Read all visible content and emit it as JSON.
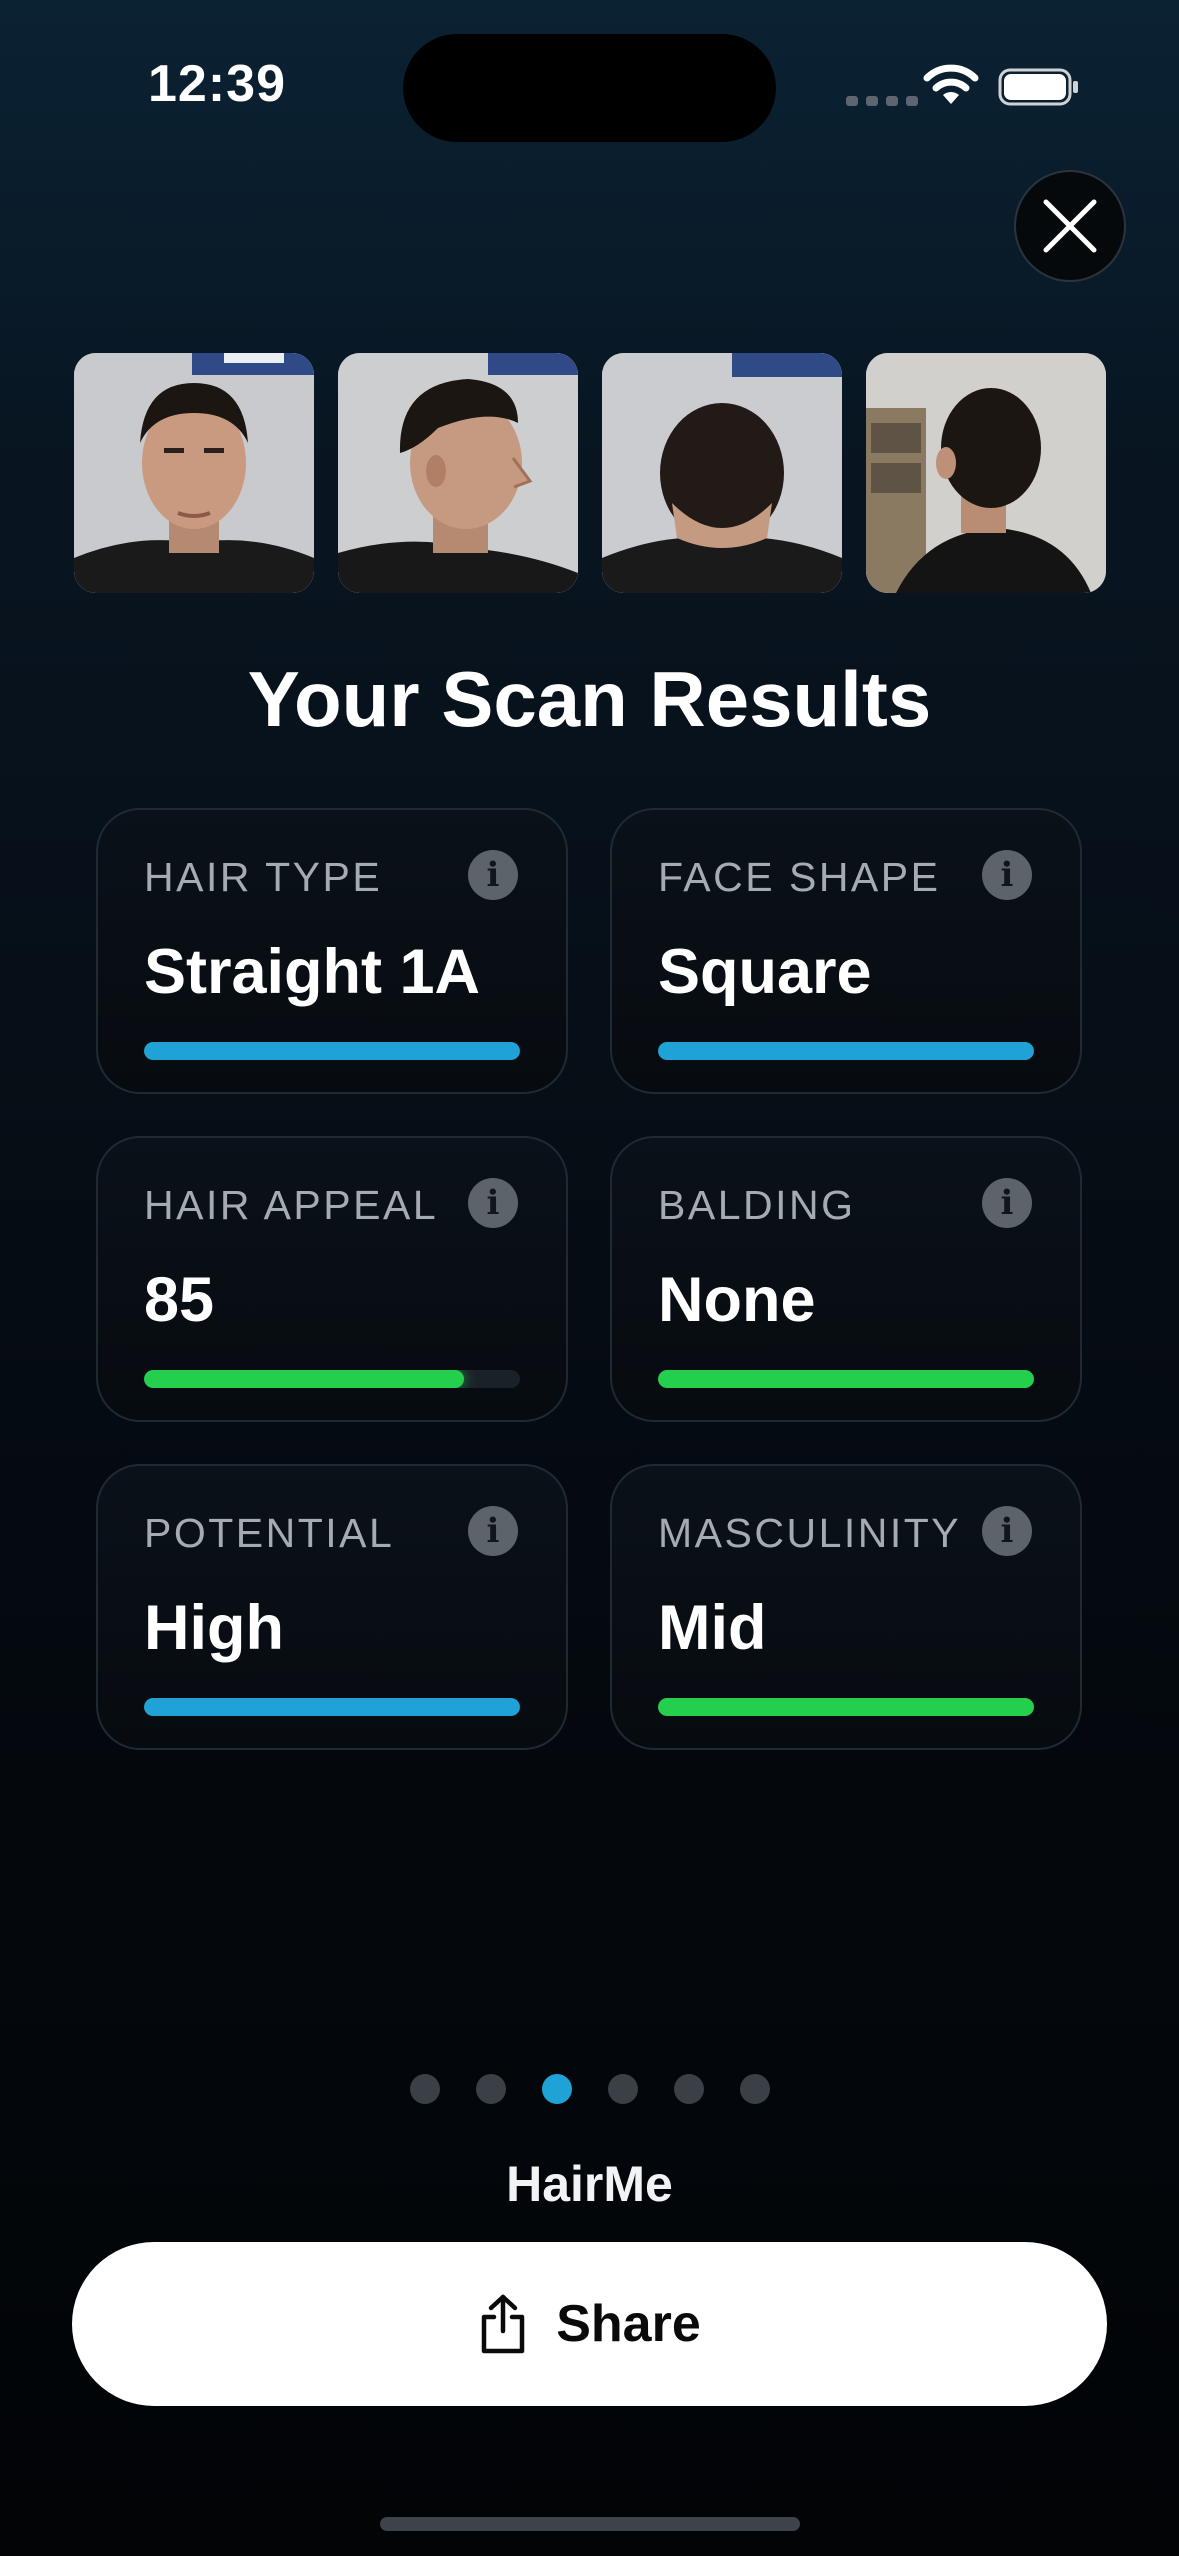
{
  "status_bar": {
    "time": "12:39"
  },
  "photos": [
    {
      "view": "front"
    },
    {
      "view": "side"
    },
    {
      "view": "top"
    },
    {
      "view": "back"
    }
  ],
  "title": "Your Scan Results",
  "cards": [
    {
      "label": "HAIR TYPE",
      "value": "Straight 1A",
      "bar_percent": 100,
      "bar_color": "#1fa3d6"
    },
    {
      "label": "FACE SHAPE",
      "value": "Square",
      "bar_percent": 100,
      "bar_color": "#1fa3d6"
    },
    {
      "label": "HAIR APPEAL",
      "value": "85",
      "bar_percent": 85,
      "bar_color": "#25cf4e"
    },
    {
      "label": "BALDING",
      "value": "None",
      "bar_percent": 100,
      "bar_color": "#25cf4e"
    },
    {
      "label": "POTENTIAL",
      "value": "High",
      "bar_percent": 100,
      "bar_color": "#1fa3d6"
    },
    {
      "label": "MASCULINITY",
      "value": "Mid",
      "bar_percent": 100,
      "bar_color": "#25cf4e"
    }
  ],
  "pager": {
    "count": 6,
    "active_index": 2
  },
  "brand": "HairMe",
  "share_button": {
    "label": "Share",
    "icon": "share-icon"
  },
  "colors": {
    "accent_blue": "#1fa3d6",
    "accent_green": "#25cf4e"
  }
}
